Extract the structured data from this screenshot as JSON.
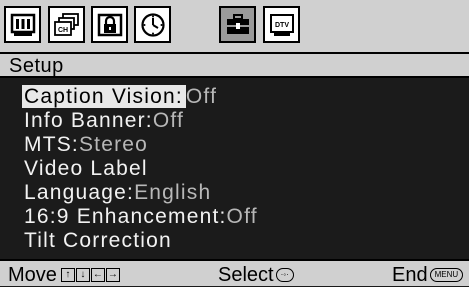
{
  "icons": [
    {
      "name": "picture-menu-icon",
      "selected": false
    },
    {
      "name": "channel-menu-icon",
      "selected": false
    },
    {
      "name": "lock-menu-icon",
      "selected": false
    },
    {
      "name": "timer-menu-icon",
      "selected": false
    },
    {
      "name": "setup-menu-icon",
      "selected": true
    },
    {
      "name": "dtv-menu-icon",
      "selected": false,
      "text": "DTV"
    }
  ],
  "title": "Setup",
  "items": [
    {
      "label": "Caption Vision:",
      "value": "Off",
      "highlighted": true
    },
    {
      "label": "Info Banner:",
      "value": "Off"
    },
    {
      "label": "MTS:",
      "value": "Stereo"
    },
    {
      "label": "Video Label",
      "value": ""
    },
    {
      "label": "Language:",
      "value": "English"
    },
    {
      "label": "16:9 Enhancement:",
      "value": "Off"
    },
    {
      "label": "Tilt Correction",
      "value": ""
    }
  ],
  "footer": {
    "move_label": "Move",
    "select_label": "Select",
    "end_label": "End",
    "end_key": "MENU"
  },
  "colors": {
    "bar_bg": "#d0d0d0",
    "menu_bg": "#1b1b1b",
    "label_text": "#f2f2f2",
    "value_text": "#b8b8b8",
    "highlight_bg": "#e8e8e8"
  }
}
